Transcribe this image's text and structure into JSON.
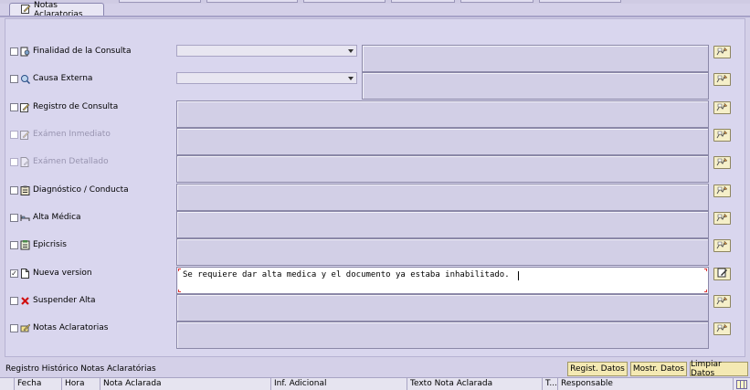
{
  "tab": {
    "label": "Notas Aclaratorias",
    "icon": "edit-note-icon"
  },
  "rows": [
    {
      "label": "Finalidad de la Consulta",
      "icon": "consult-icon",
      "checked": false,
      "disabled": false,
      "type": "combo",
      "value": ""
    },
    {
      "label": "Causa Externa",
      "icon": "search-person-icon",
      "checked": false,
      "disabled": false,
      "type": "combo",
      "value": ""
    },
    {
      "label": "Registro de Consulta",
      "icon": "pencil-note-icon",
      "checked": false,
      "disabled": false,
      "type": "text",
      "value": ""
    },
    {
      "label": "Exámen Inmediato",
      "icon": "pencil-note-icon",
      "checked": false,
      "disabled": true,
      "type": "text",
      "value": ""
    },
    {
      "label": "Exámen Detallado",
      "icon": "document-edit-icon",
      "checked": false,
      "disabled": true,
      "type": "text",
      "value": ""
    },
    {
      "label": "Diagnóstico / Conducta",
      "icon": "clipboard-icon",
      "checked": false,
      "disabled": false,
      "type": "text",
      "value": ""
    },
    {
      "label": "Alta Médica",
      "icon": "bed-icon",
      "checked": false,
      "disabled": false,
      "type": "text",
      "value": ""
    },
    {
      "label": "Epicrisis",
      "icon": "report-icon",
      "checked": false,
      "disabled": false,
      "type": "text",
      "value": ""
    },
    {
      "label": "Nueva version",
      "icon": "new-document-icon",
      "checked": true,
      "disabled": false,
      "type": "text",
      "value": "Se requiere dar alta medica y el documento ya estaba inhabilitado."
    },
    {
      "label": "Suspender Alta",
      "icon": "red-x-icon",
      "checked": false,
      "disabled": false,
      "type": "text",
      "value": ""
    },
    {
      "label": "Notas Aclaratorias",
      "icon": "note-pencil-icon",
      "checked": false,
      "disabled": false,
      "type": "text",
      "value": ""
    }
  ],
  "history": {
    "label": "Registro Histórico Notas Aclaratórias"
  },
  "buttons": {
    "register": "Regist. Datos",
    "show": "Mostr. Datos",
    "clear": "Limpiar Datos"
  },
  "grid_columns": [
    "Fecha",
    "Hora",
    "Nota Aclarada",
    "Inf. Adicional",
    "Texto Nota Aclarada",
    "T...",
    "Responsable"
  ],
  "colors": {
    "panel": "#d9d6ee",
    "button": "#f4e9b3",
    "textbox": "#d2cfe6",
    "active_textbox": "#ffffff"
  }
}
